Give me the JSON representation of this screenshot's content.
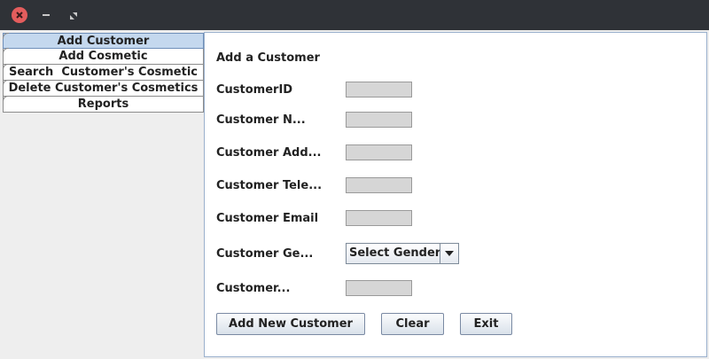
{
  "titlebar": {
    "close_icon": "close-icon",
    "minimize_icon": "minimize-icon",
    "maximize_icon": "maximize-icon"
  },
  "tabs": [
    {
      "label": "Add Customer",
      "selected": true
    },
    {
      "label": "Add Cosmetic",
      "selected": false
    },
    {
      "label": "Search  Customer's Cosmetic",
      "selected": false
    },
    {
      "label": "Delete Customer's Cosmetics",
      "selected": false
    },
    {
      "label": "Reports",
      "selected": false
    }
  ],
  "form": {
    "heading": "Add a Customer",
    "fields": [
      {
        "label": "CustomerID",
        "value": ""
      },
      {
        "label": "Customer N...",
        "value": ""
      },
      {
        "label": "Customer Add...",
        "value": ""
      },
      {
        "label": "Customer Tele...",
        "value": ""
      },
      {
        "label": "Customer Email",
        "value": ""
      }
    ],
    "gender": {
      "label": "Customer Ge...",
      "selected": "Select Gender"
    },
    "last_field": {
      "label": "Customer...",
      "value": ""
    }
  },
  "buttons": {
    "add": "Add New Customer",
    "clear": "Clear",
    "exit": "Exit"
  },
  "colors": {
    "titlebar": "#2f3237",
    "close": "#e45d5d",
    "selected_tab": "#c4d8ee",
    "field_bg": "#d6d6d6"
  }
}
